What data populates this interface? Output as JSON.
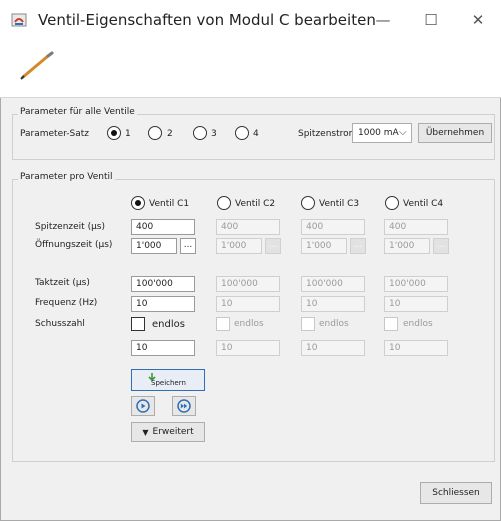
{
  "window": {
    "title": "Ventil-Eigenschaften von Modul C bearbeiten",
    "controls": {
      "minimize": "—",
      "maximize": "☐",
      "close": "✕"
    }
  },
  "group_all": {
    "title": "Parameter für alle Ventile",
    "param_set_label": "Parameter-Satz",
    "radios": [
      "1",
      "2",
      "3",
      "4"
    ],
    "selected": "1",
    "peak_label": "Spitzenstrom",
    "peak_value": "1000 mA",
    "apply_button": "Übernehmen"
  },
  "group_per": {
    "title": "Parameter pro Ventil",
    "valves": [
      "Ventil C1",
      "Ventil C2",
      "Ventil C3",
      "Ventil C4"
    ],
    "selected_valve": "Ventil C1",
    "labels": {
      "spitzenzeit": "Spitzenzeit (µs)",
      "oeffnungszeit": "Öffnungszeit (µs)",
      "taktzeit": "Taktzeit (µs)",
      "frequenz": "Frequenz (Hz)",
      "schusszahl": "Schusszahl"
    },
    "values": {
      "spitzenzeit": [
        "400",
        "400",
        "400",
        "400"
      ],
      "oeffnungszeit": [
        "1'000",
        "1'000",
        "1'000",
        "1'000"
      ],
      "taktzeit": [
        "100'000",
        "100'000",
        "100'000",
        "100'000"
      ],
      "frequenz": [
        "10",
        "10",
        "10",
        "10"
      ],
      "endlos": "endlos",
      "schusszahl": [
        "10",
        "10",
        "10",
        "10"
      ]
    },
    "dots": "...",
    "save_button": "Speichern",
    "extended_button": "Erweitert",
    "extended_arrow": "▼"
  },
  "close_button": "Schliessen",
  "colors": {
    "play_icon": "#2f6fb6",
    "save_icon": "#3b9a3b",
    "pencil": "#d28a2a"
  }
}
